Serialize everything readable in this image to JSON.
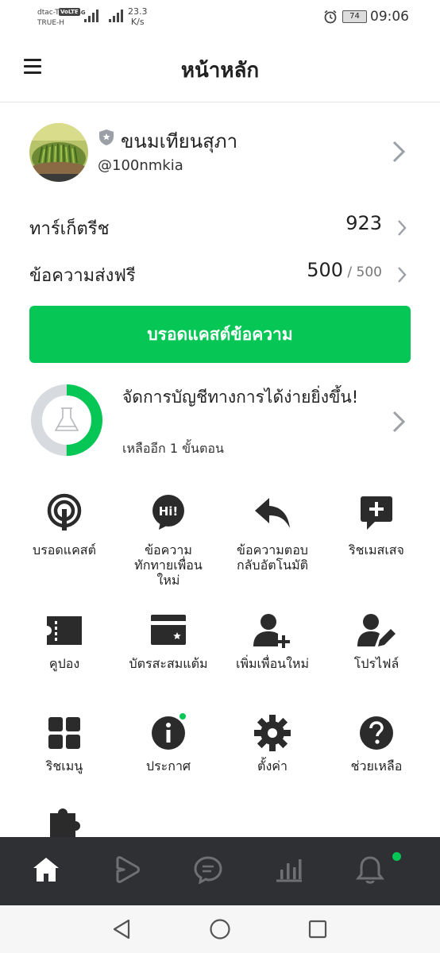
{
  "status_bar": {
    "carrier1": "dtac-T",
    "carrier2": "TRUE-H",
    "volte": "VoLTE",
    "net": "4G",
    "speed_value": "23.3",
    "speed_unit": "K/s",
    "battery": "74",
    "time": "09:06"
  },
  "header": {
    "title": "หน้าหลัก",
    "menu_icon": "hamburger-menu-icon"
  },
  "account": {
    "name": "ขนมเทียนสุภา",
    "id": "@100nmkia",
    "badge_icon": "shield-icon"
  },
  "stats": [
    {
      "label": "ทาร์เก็ตรีช",
      "value": "923"
    },
    {
      "label": "ข้อความส่งฟรี",
      "value": "500",
      "sub": " / 500"
    }
  ],
  "broadcast_button": "บรอดแคสต์ข้อความ",
  "setup": {
    "title": "จัดการบัญชีทางการได้ง่ายยิ่งขึ้น!",
    "subtitle": "เหลืออีก 1 ขั้นตอน",
    "progress": 0.5,
    "icon": "flask-icon"
  },
  "menu_grid": [
    {
      "label": "บรอดแคสต์",
      "icon": "broadcast-icon"
    },
    {
      "label": "ข้อความทักทายเพื่อนใหม่",
      "icon": "greeting-message-icon",
      "icon_text": "Hi!"
    },
    {
      "label": "ข้อความตอบกลับอัตโนมัติ",
      "icon": "auto-reply-icon"
    },
    {
      "label": "ริชเมสเสจ",
      "icon": "rich-message-icon"
    },
    {
      "label": "คูปอง",
      "icon": "coupon-icon"
    },
    {
      "label": "บัตรสะสมแต้ม",
      "icon": "reward-card-icon"
    },
    {
      "label": "เพิ่มเพื่อนใหม่",
      "icon": "add-friend-icon"
    },
    {
      "label": "โปรไฟล์",
      "icon": "profile-edit-icon"
    },
    {
      "label": "ริชเมนู",
      "icon": "rich-menu-icon"
    },
    {
      "label": "ประกาศ",
      "icon": "announcement-icon"
    },
    {
      "label": "ตั้งค่า",
      "icon": "settings-gear-icon"
    },
    {
      "label": "ช่วยเหลือ",
      "icon": "help-icon"
    },
    {
      "label": "",
      "icon": "puzzle-icon"
    }
  ],
  "bottom_nav": [
    {
      "icon": "home-icon",
      "active": true
    },
    {
      "icon": "timeline-play-icon"
    },
    {
      "icon": "chat-icon"
    },
    {
      "icon": "insight-chart-icon"
    },
    {
      "icon": "notification-bell-icon",
      "badge": true
    }
  ],
  "colors": {
    "accent_green": "#06c755",
    "nav_bg": "#2f3033",
    "icon_dark": "#2b2b2b",
    "ring_track": "#d7dade"
  }
}
